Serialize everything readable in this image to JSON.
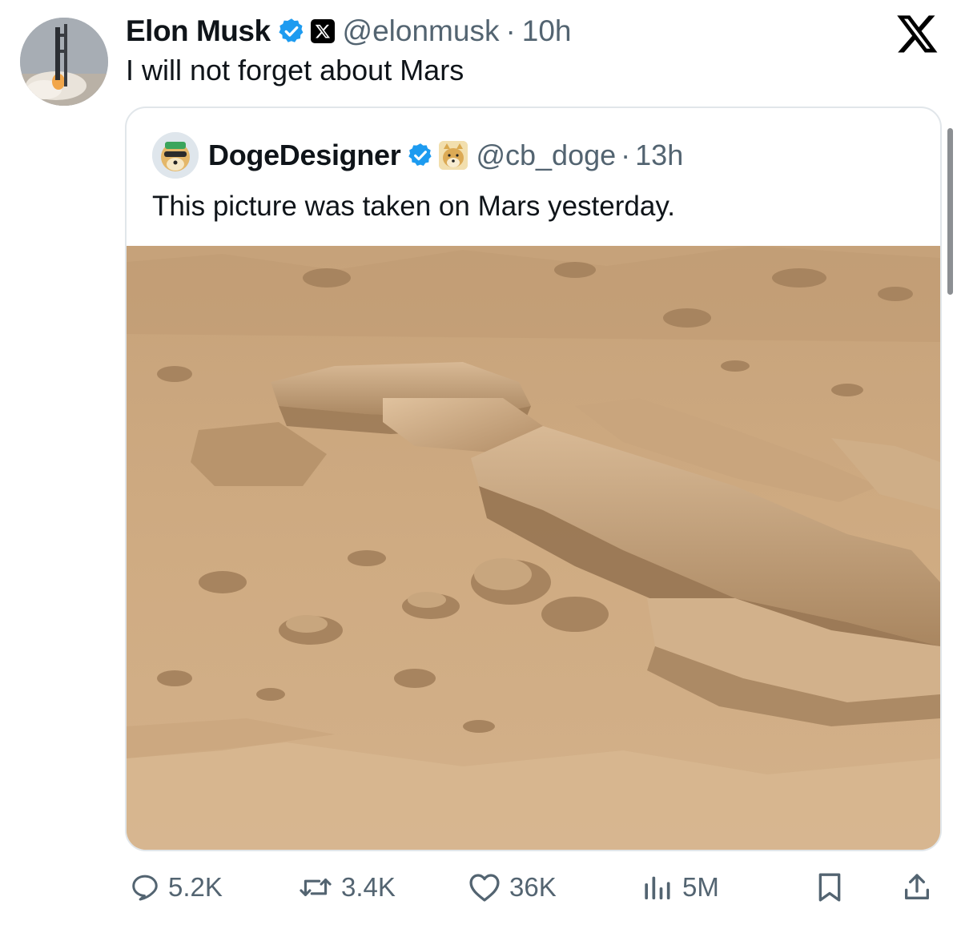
{
  "tweet": {
    "author_name": "Elon Musk",
    "handle": "@elonmusk",
    "separator": "·",
    "time": "10h",
    "text": "I will not forget about Mars"
  },
  "quoted_tweet": {
    "author_name": "DogeDesigner",
    "handle": "@cb_doge",
    "separator": "·",
    "time": "13h",
    "text": "This picture was taken on Mars yesterday."
  },
  "actions": {
    "replies": "5.2K",
    "reposts": "3.4K",
    "likes": "36K",
    "views": "5M"
  },
  "icons": {
    "verified": "verified-badge-icon",
    "affiliate": "x-affiliate-icon",
    "brand": "x-logo-icon",
    "reply": "reply-icon",
    "repost": "repost-icon",
    "like": "heart-icon",
    "views": "views-icon",
    "bookmark": "bookmark-icon",
    "share": "share-icon"
  },
  "colors": {
    "verified_blue": "#1d9bf0",
    "secondary_text": "#536471",
    "mars_sand": "#c9a57c"
  }
}
